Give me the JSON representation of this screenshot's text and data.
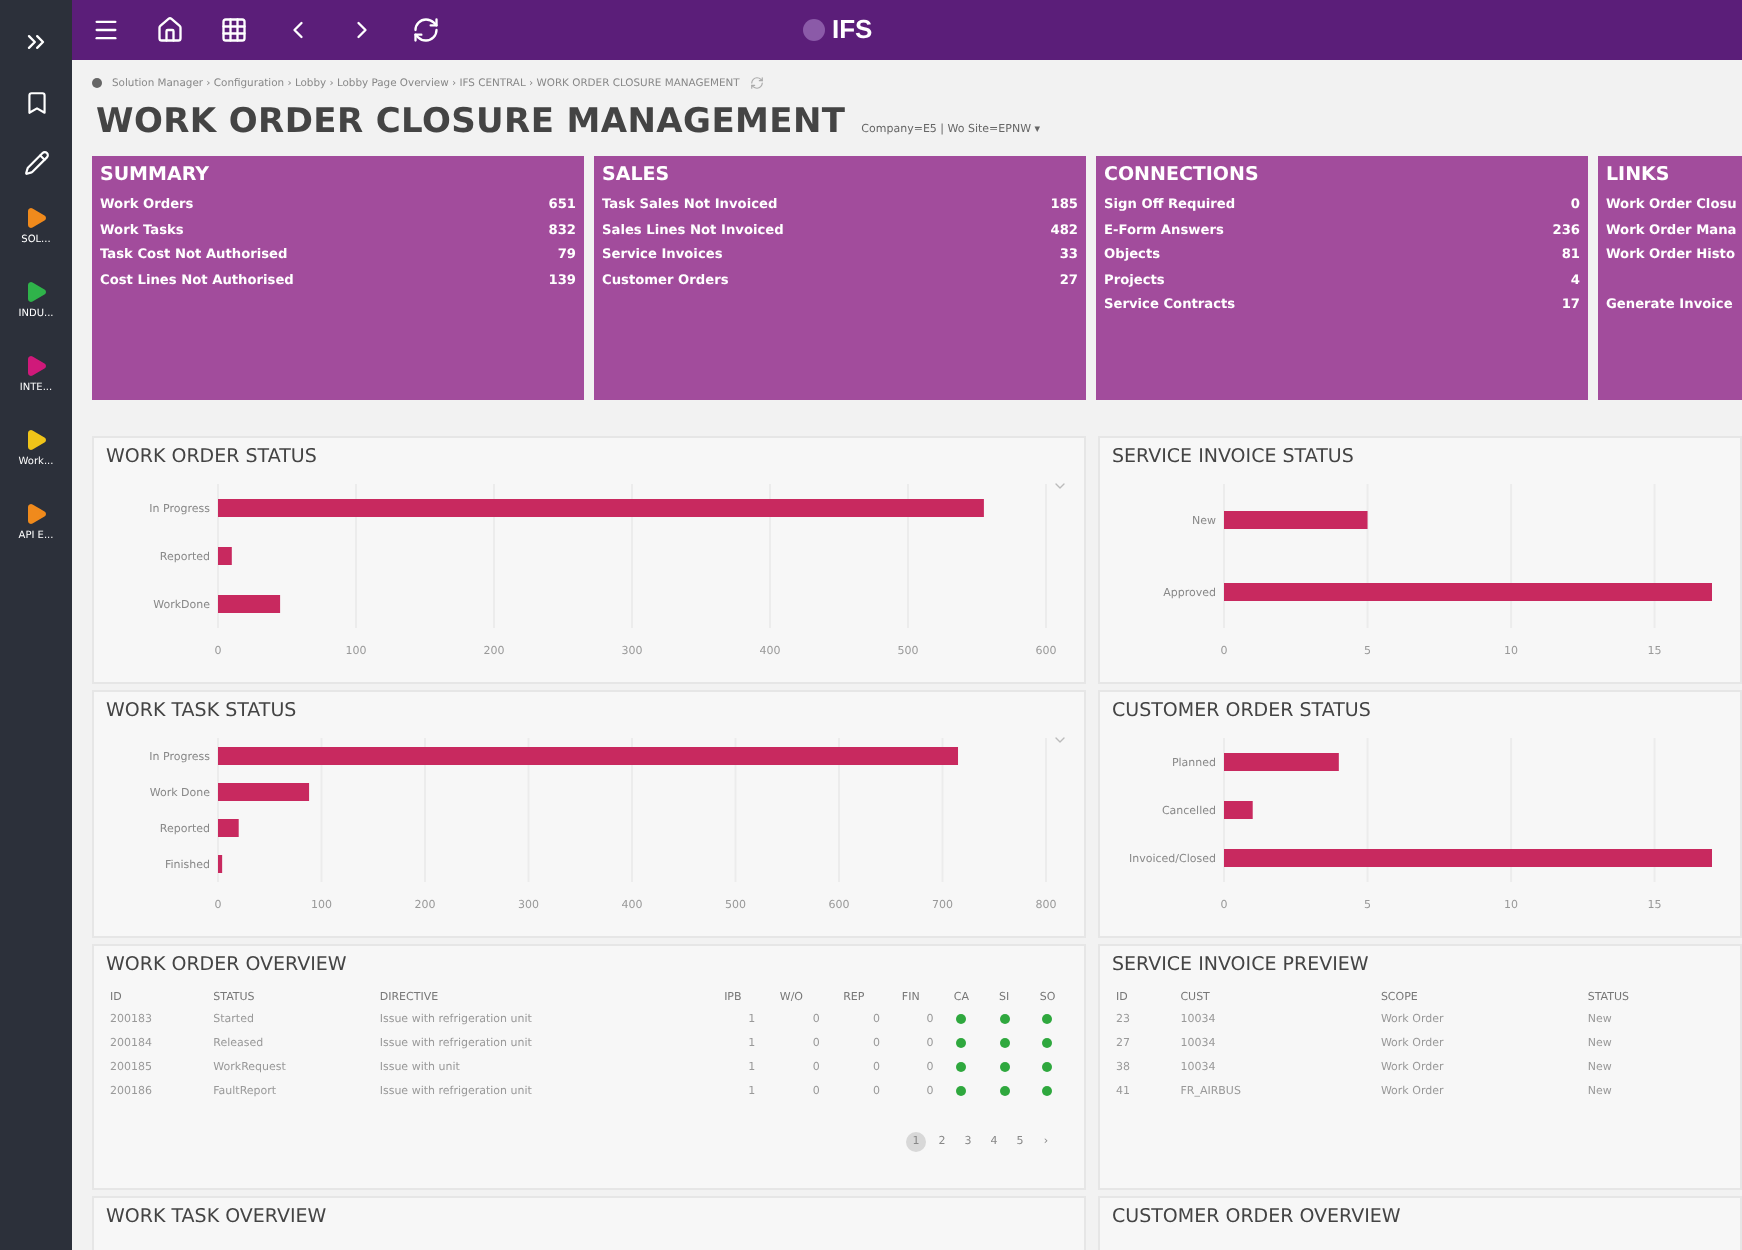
{
  "sidebar": {
    "items": [
      {
        "label": "SOL...",
        "color": "#f08a1c"
      },
      {
        "label": "INDU...",
        "color": "#2fb34a"
      },
      {
        "label": "INTE...",
        "color": "#d0197a"
      },
      {
        "label": "Work...",
        "color": "#f0c419"
      },
      {
        "label": "API E...",
        "color": "#f08a1c"
      }
    ]
  },
  "topbar": {
    "logo": "IFS"
  },
  "breadcrumb": "Solution Manager › Configuration › Lobby › Lobby Page Overview › IFS CENTRAL › WORK ORDER CLOSURE MANAGEMENT",
  "page": {
    "title": "WORK ORDER CLOSURE MANAGEMENT",
    "context": "Company=E5 | Wo Site=EPNW ▾"
  },
  "cards": [
    {
      "title": "SUMMARY",
      "items": [
        {
          "label": "Work Orders",
          "value": "651"
        },
        {
          "label": "Work Tasks",
          "value": "832"
        },
        {
          "label": "Task Cost Not Authorised",
          "value": "79"
        },
        {
          "label": "Cost Lines Not Authorised",
          "value": "139"
        }
      ]
    },
    {
      "title": "SALES",
      "items": [
        {
          "label": "Task Sales Not Invoiced",
          "value": "185"
        },
        {
          "label": "Sales Lines Not Invoiced",
          "value": "482"
        },
        {
          "label": "Service Invoices",
          "value": "33"
        },
        {
          "label": "Customer Orders",
          "value": "27"
        }
      ]
    },
    {
      "title": "CONNECTIONS",
      "items": [
        {
          "label": "Sign Off Required",
          "value": "0"
        },
        {
          "label": "E-Form Answers",
          "value": "236"
        },
        {
          "label": "Objects",
          "value": "81"
        },
        {
          "label": "Projects",
          "value": "4"
        },
        {
          "label": "Service Contracts",
          "value": "17"
        }
      ]
    },
    {
      "title": "LINKS",
      "links": [
        "Work Order Closu",
        "Work Order Mana",
        "Work Order Histo"
      ],
      "more_links": [
        "Generate Invoice"
      ]
    }
  ],
  "charts": [
    {
      "title": "WORK ORDER STATUS",
      "collapsible": true,
      "chart_data": {
        "type": "bar",
        "orientation": "horizontal",
        "categories": [
          "In Progress",
          "Reported",
          "WorkDone"
        ],
        "grid": true,
        "series": [
          {
            "color": "#c8295f",
            "values": [
              555,
              10,
              45
            ]
          }
        ],
        "xlim": [
          0,
          600
        ],
        "xticks": [
          0,
          100,
          200,
          300,
          400,
          500,
          600
        ]
      }
    },
    {
      "title": "SERVICE INVOICE STATUS",
      "collapsible": false,
      "chart_data": {
        "type": "bar",
        "orientation": "horizontal",
        "categories": [
          "New",
          "Approved"
        ],
        "grid": true,
        "series": [
          {
            "color": "#c8295f",
            "values": [
              5,
              17
            ]
          }
        ],
        "xlim": [
          0,
          17
        ],
        "xticks": [
          0,
          5,
          10,
          15
        ]
      }
    },
    {
      "title": "WORK TASK STATUS",
      "collapsible": true,
      "chart_data": {
        "type": "bar",
        "orientation": "horizontal",
        "categories": [
          "In Progress",
          "Work Done",
          "Reported",
          "Finished"
        ],
        "grid": true,
        "series": [
          {
            "color": "#c8295f",
            "values": [
              715,
              88,
              20,
              4
            ]
          }
        ],
        "xlim": [
          0,
          800
        ],
        "xticks": [
          0,
          100,
          200,
          300,
          400,
          500,
          600,
          700,
          800
        ]
      }
    },
    {
      "title": "CUSTOMER ORDER STATUS",
      "collapsible": false,
      "chart_data": {
        "type": "bar",
        "orientation": "horizontal",
        "categories": [
          "Planned",
          "Cancelled",
          "Invoiced/Closed"
        ],
        "grid": true,
        "series": [
          {
            "color": "#c8295f",
            "values": [
              4,
              1,
              17
            ]
          }
        ],
        "xlim": [
          0,
          17
        ],
        "xticks": [
          0,
          5,
          10,
          15
        ]
      }
    }
  ],
  "work_order_overview": {
    "title": "WORK ORDER OVERVIEW",
    "columns": [
      "ID",
      "STATUS",
      "DIRECTIVE",
      "IPB",
      "W/O",
      "REP",
      "FIN",
      "CA",
      "SI",
      "SO"
    ],
    "rows": [
      {
        "cells": [
          "200183",
          "Started",
          "Issue with refrigeration unit",
          "1",
          "0",
          "0",
          "0"
        ],
        "indicators": [
          {
            "color": "#2fa83e"
          },
          {
            "color": "#2fa83e"
          },
          {
            "color": "#2fa83e"
          }
        ]
      },
      {
        "cells": [
          "200184",
          "Released",
          "Issue with refrigeration unit",
          "1",
          "0",
          "0",
          "0"
        ],
        "indicators": [
          {
            "color": "#2fa83e"
          },
          {
            "color": "#2fa83e"
          },
          {
            "color": "#2fa83e"
          }
        ]
      },
      {
        "cells": [
          "200185",
          "WorkRequest",
          "Issue with unit",
          "1",
          "0",
          "0",
          "0"
        ],
        "indicators": [
          {
            "color": "#2fa83e"
          },
          {
            "color": "#2fa83e"
          },
          {
            "color": "#2fa83e"
          }
        ]
      },
      {
        "cells": [
          "200186",
          "FaultReport",
          "Issue with refrigeration unit",
          "1",
          "0",
          "0",
          "0"
        ],
        "indicators": [
          {
            "color": "#2fa83e"
          },
          {
            "color": "#2fa83e"
          },
          {
            "color": "#2fa83e"
          }
        ]
      }
    ],
    "pages": [
      {
        "label": "1",
        "selected": true
      },
      {
        "label": "2",
        "selected": false
      },
      {
        "label": "3",
        "selected": false
      },
      {
        "label": "4",
        "selected": false
      },
      {
        "label": "5",
        "selected": false
      },
      {
        "label": "›",
        "selected": false
      }
    ]
  },
  "service_invoice_preview": {
    "title": "SERVICE INVOICE PREVIEW",
    "columns": [
      "ID",
      "CUST",
      "SCOPE",
      "STATUS"
    ],
    "rows": [
      [
        "23",
        "10034",
        "Work Order",
        "New"
      ],
      [
        "27",
        "10034",
        "Work Order",
        "New"
      ],
      [
        "38",
        "10034",
        "Work Order",
        "New"
      ],
      [
        "41",
        "FR_AIRBUS",
        "Work Order",
        "New"
      ]
    ]
  },
  "bottom_sections": [
    "WORK TASK OVERVIEW",
    "CUSTOMER ORDER OVERVIEW"
  ]
}
